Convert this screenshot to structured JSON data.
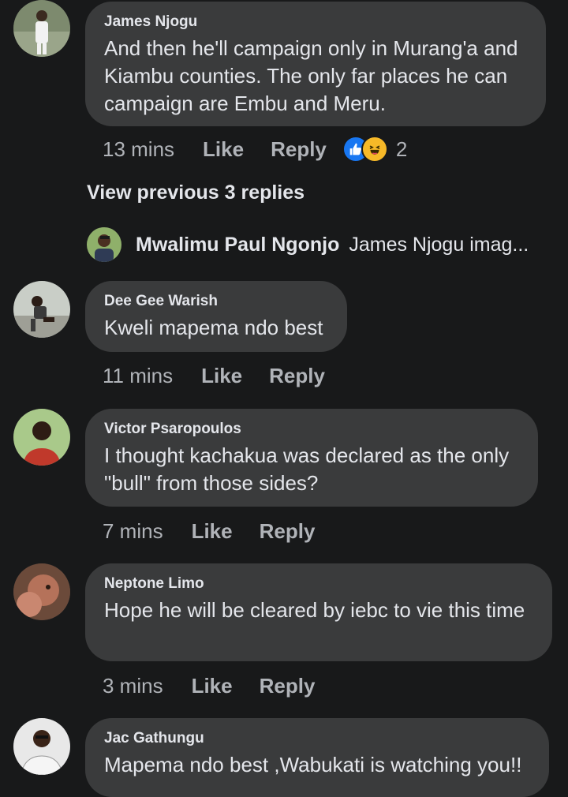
{
  "comments": [
    {
      "author": "James Njogu",
      "text": "And then he'll campaign only in Murang'a and Kiambu counties. The only far places he can campaign are Embu and Meru.",
      "time": "13 mins",
      "like_label": "Like",
      "reply_label": "Reply",
      "reaction_count": "2",
      "reactions": [
        "like-icon",
        "haha-icon"
      ]
    },
    {
      "author": "Dee Gee Warish",
      "text": "Kweli mapema ndo best",
      "time": "11 mins",
      "like_label": "Like",
      "reply_label": "Reply"
    },
    {
      "author": "Victor Psaropoulos",
      "text": "I thought kachakua was declared as the only \"bull\" from those sides?",
      "time": "7 mins",
      "like_label": "Like",
      "reply_label": "Reply"
    },
    {
      "author": "Neptone Limo",
      "text": "Hope he will be cleared by iebc to vie this time",
      "time": "3 mins",
      "like_label": "Like",
      "reply_label": "Reply"
    },
    {
      "author": "Jac Gathungu",
      "text": "Mapema ndo best ,Wabukati is watching you!!"
    }
  ],
  "view_previous": "View previous 3 replies",
  "collapsed_reply": {
    "author": "Mwalimu Paul Ngonjo",
    "text": "James Njogu imag..."
  },
  "colors": {
    "background": "#18191a",
    "bubble": "#3a3b3c",
    "text": "#e4e6eb",
    "secondary": "#b0b3b8",
    "like_blue": "#1877f2",
    "haha_yellow": "#f7b928"
  }
}
